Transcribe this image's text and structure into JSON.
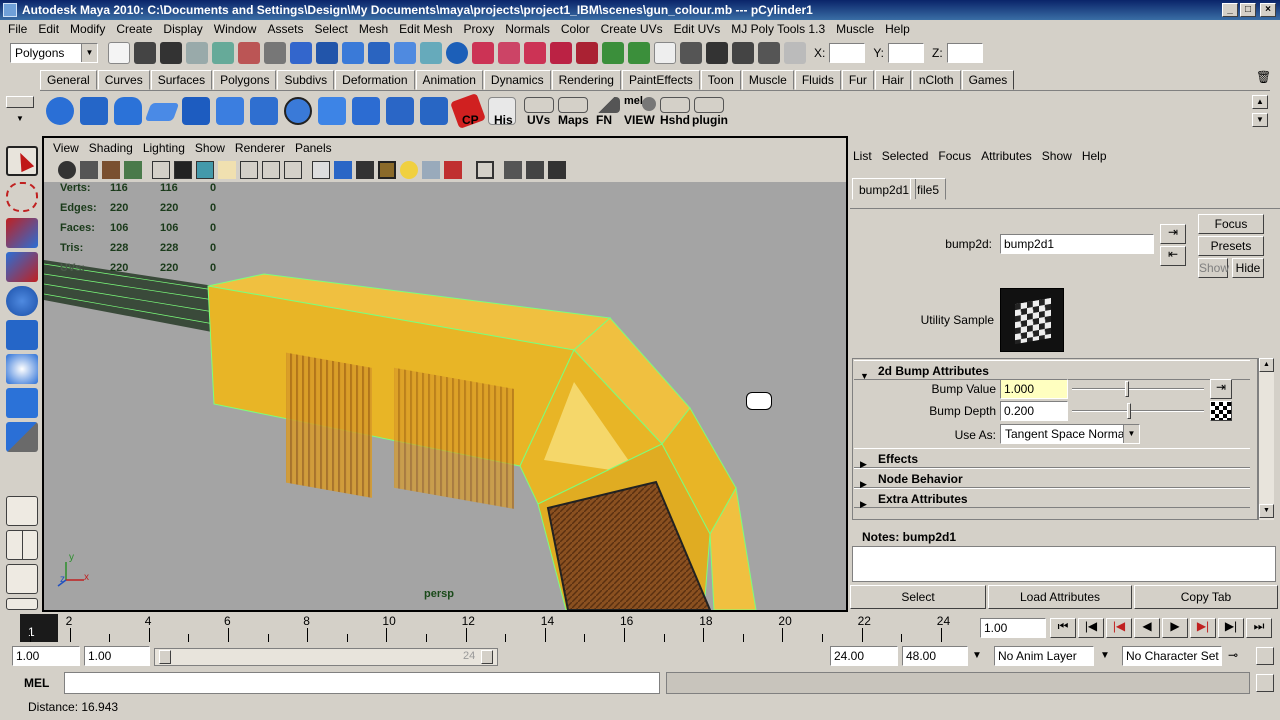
{
  "window": {
    "title": "Autodesk Maya 2010: C:\\Documents and Settings\\Design\\My Documents\\maya\\projects\\project1_IBM\\scenes\\gun_colour.mb  ---  pCylinder1",
    "min": "_",
    "max": "□",
    "close": "×"
  },
  "menu": [
    "File",
    "Edit",
    "Modify",
    "Create",
    "Display",
    "Window",
    "Assets",
    "Select",
    "Mesh",
    "Edit Mesh",
    "Proxy",
    "Normals",
    "Color",
    "Create UVs",
    "Edit UVs",
    "MJ Poly Tools 1.3",
    "Muscle",
    "Help"
  ],
  "statusline": {
    "menuset": "Polygons",
    "x_label": "X:",
    "y_label": "Y:",
    "z_label": "Z:"
  },
  "shelf_tabs": [
    "General",
    "Curves",
    "Surfaces",
    "Polygons",
    "Subdivs",
    "Deformation",
    "Animation",
    "Dynamics",
    "Rendering",
    "PaintEffects",
    "Toon",
    "Muscle",
    "Fluids",
    "Fur",
    "Hair",
    "nCloth",
    "Games"
  ],
  "shelf_labels": {
    "cp": "CP",
    "his": "His",
    "uvs": "UVs",
    "maps": "Maps",
    "fn": "FN",
    "mel": "mel",
    "view": "VIEW",
    "hshd": "Hshd",
    "plugin": "plugin"
  },
  "viewport": {
    "menu": [
      "View",
      "Shading",
      "Lighting",
      "Show",
      "Renderer",
      "Panels"
    ],
    "camera": "persp",
    "hud": [
      {
        "label": "Verts:",
        "a": "116",
        "b": "116",
        "c": "0"
      },
      {
        "label": "Edges:",
        "a": "220",
        "b": "220",
        "c": "0"
      },
      {
        "label": "Faces:",
        "a": "106",
        "b": "106",
        "c": "0"
      },
      {
        "label": "Tris:",
        "a": "228",
        "b": "228",
        "c": "0"
      },
      {
        "label": "UVs:",
        "a": "220",
        "b": "220",
        "c": "0"
      }
    ],
    "axis_x": "x",
    "axis_y": "y",
    "axis_z": "z"
  },
  "attribute_editor": {
    "menu": [
      "List",
      "Selected",
      "Focus",
      "Attributes",
      "Show",
      "Help"
    ],
    "tabs": [
      "bump2d1",
      "file5"
    ],
    "node_label": "bump2d:",
    "node_name": "bump2d1",
    "focus": "Focus",
    "presets": "Presets",
    "show": "Show",
    "hide": "Hide",
    "utility_sample": "Utility Sample",
    "section_bump": "2d Bump Attributes",
    "bump_value_label": "Bump Value",
    "bump_value": "1.000",
    "bump_value_level": 0.4,
    "bump_depth_label": "Bump Depth",
    "bump_depth": "0.200",
    "bump_depth_level": 0.42,
    "use_as_label": "Use As:",
    "use_as": "Tangent Space Normals",
    "sections": [
      "Effects",
      "Node Behavior",
      "Extra Attributes"
    ],
    "notes_label": "Notes:  bump2d1",
    "buttons": [
      "Select",
      "Load Attributes",
      "Copy Tab"
    ]
  },
  "timeline": {
    "numbers": [
      "2",
      "4",
      "6",
      "8",
      "10",
      "12",
      "14",
      "16",
      "18",
      "20",
      "22",
      "24"
    ],
    "current_frame": "1",
    "current_field": "1.00"
  },
  "range": {
    "start": "1.00",
    "playback_start": "1.00",
    "slider_end_label": "24",
    "playback_end": "24.00",
    "end": "48.00",
    "anim_layer": "No Anim Layer",
    "character_set": "No Character Set"
  },
  "mel": {
    "label": "MEL"
  },
  "help_line": "Distance:  16.943",
  "colors": {
    "title_start": "#0a246a",
    "viewport_bg": "#a4a4a4",
    "mesh_yellow": "#e8b526",
    "wireframe": "#7cff7c",
    "highlight_field": "#ffffc0"
  }
}
